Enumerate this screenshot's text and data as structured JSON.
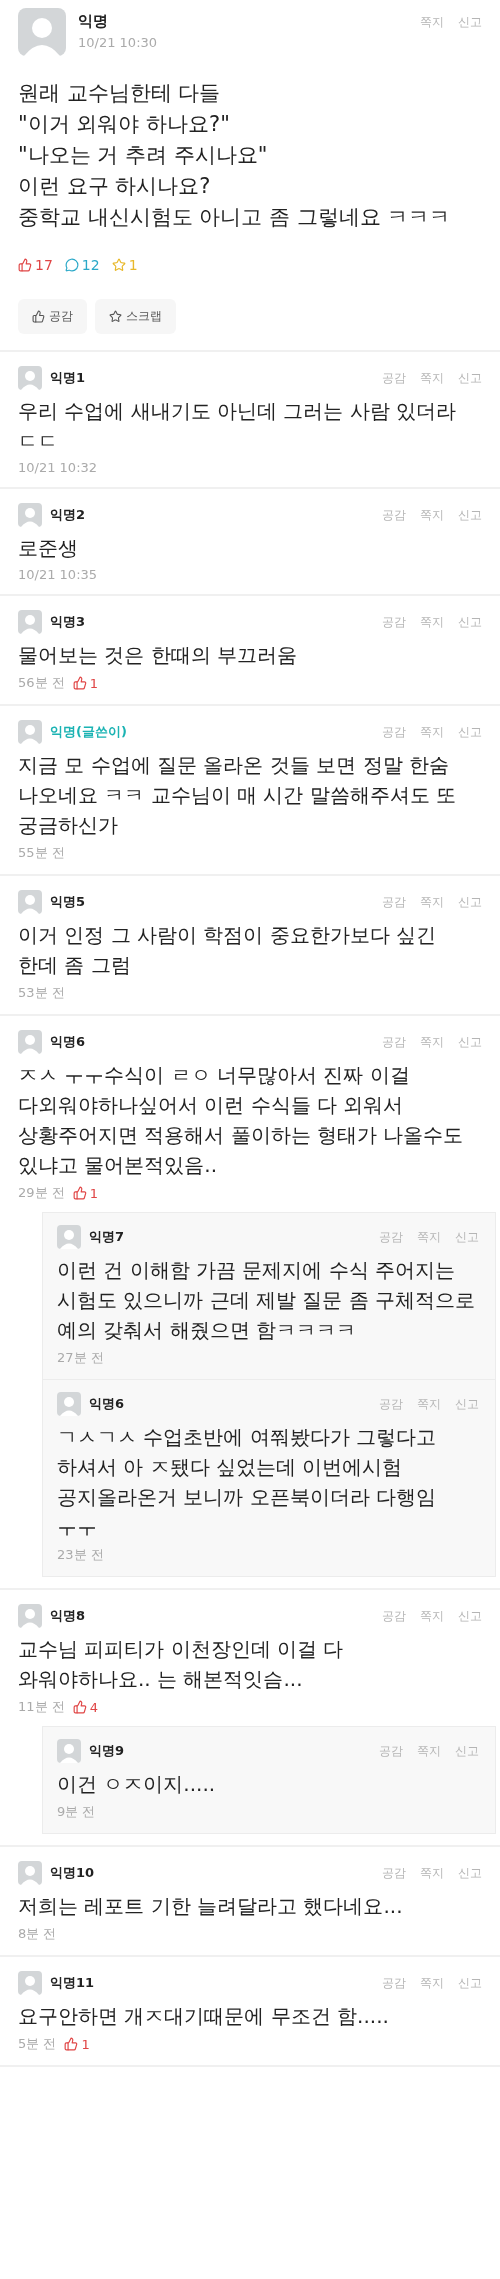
{
  "post": {
    "author": "익명",
    "time": "10/21 10:30",
    "actions": [
      "쪽지",
      "신고"
    ],
    "body": "원래 교수님한테 다들\n\"이거 외워야 하나요?\"\n\"나오는 거 추려 주시나요\"\n이런 요구 하시나요?\n중학교 내신시험도 아니고 좀 그렇네요 ㅋㅋㅋ",
    "stats": [
      {
        "kind": "like",
        "count": "17"
      },
      {
        "kind": "comment",
        "count": "12"
      },
      {
        "kind": "scrap",
        "count": "1"
      }
    ],
    "buttons": [
      {
        "kind": "like",
        "label": "공감"
      },
      {
        "kind": "scrap",
        "label": "스크랩"
      }
    ]
  },
  "comments": [
    {
      "author": "익명1",
      "is_writer": false,
      "actions": [
        "공감",
        "쪽지",
        "신고"
      ],
      "text": "우리 수업에 새내기도 아닌데 그러는 사람 있더라 ㄷㄷ",
      "time": "10/21 10:32"
    },
    {
      "author": "익명2",
      "is_writer": false,
      "actions": [
        "공감",
        "쪽지",
        "신고"
      ],
      "text": "로준생",
      "time": "10/21 10:35"
    },
    {
      "author": "익명3",
      "is_writer": false,
      "actions": [
        "공감",
        "쪽지",
        "신고"
      ],
      "text": "물어보는 것은 한때의 부끄러움",
      "time": "56분 전",
      "likes": "1"
    },
    {
      "author": "익명(글쓴이)",
      "is_writer": true,
      "actions": [
        "공감",
        "쪽지",
        "신고"
      ],
      "text": "지금 모 수업에 질문 올라온 것들 보면 정말 한숨 나오네요 ㅋㅋ 교수님이 매 시간 말씀해주셔도 또 궁금하신가",
      "time": "55분 전"
    },
    {
      "author": "익명5",
      "is_writer": false,
      "actions": [
        "공감",
        "쪽지",
        "신고"
      ],
      "text": "이거 인정 그 사람이 학점이 중요한가보다 싶긴 한데 좀 그럼",
      "time": "53분 전"
    },
    {
      "author": "익명6",
      "is_writer": false,
      "actions": [
        "공감",
        "쪽지",
        "신고"
      ],
      "text": "ㅈㅅ ㅜㅜ수식이 ㄹㅇ 너무많아서 진짜 이걸 다외워야하나싶어서 이런 수식들 다 외워서 상황주어지면 적용해서 풀이하는 형태가 나올수도 있냐고 물어본적있음..",
      "time": "29분 전",
      "likes": "1",
      "replies": [
        {
          "author": "익명7",
          "is_writer": false,
          "actions": [
            "공감",
            "쪽지",
            "신고"
          ],
          "text": "이런 건 이해함 가끔 문제지에 수식 주어지는 시험도 있으니까 근데 제발 질문 좀 구체적으로 예의 갖춰서 해줬으면 함ㅋㅋㅋㅋ",
          "time": "27분 전"
        },
        {
          "author": "익명6",
          "is_writer": false,
          "actions": [
            "공감",
            "쪽지",
            "신고"
          ],
          "text": "ㄱㅅㄱㅅ 수업초반에 여쭤봤다가 그렇다고 하셔서 아 ㅈ됐다 싶었는데 이번에시험 공지올라온거 보니까 오픈북이더라 다행임 ㅜㅜ",
          "time": "23분 전"
        }
      ]
    },
    {
      "author": "익명8",
      "is_writer": false,
      "actions": [
        "공감",
        "쪽지",
        "신고"
      ],
      "text": "교수님 피피티가 이천장인데 이걸 다 와워야하나요.. 는 해본적잇슴...",
      "time": "11분 전",
      "likes": "4",
      "replies": [
        {
          "author": "익명9",
          "is_writer": false,
          "actions": [
            "공감",
            "쪽지",
            "신고"
          ],
          "text": "이건 ㅇㅈ이지.....",
          "time": "9분 전"
        }
      ]
    },
    {
      "author": "익명10",
      "is_writer": false,
      "actions": [
        "공감",
        "쪽지",
        "신고"
      ],
      "text": "저희는 레포트 기한 늘려달라고 했다네요...",
      "time": "8분 전"
    },
    {
      "author": "익명11",
      "is_writer": false,
      "actions": [
        "공감",
        "쪽지",
        "신고"
      ],
      "text": "요구안하면 개ㅈ대기때문에 무조건 함.....",
      "time": "5분 전",
      "likes": "1"
    }
  ]
}
